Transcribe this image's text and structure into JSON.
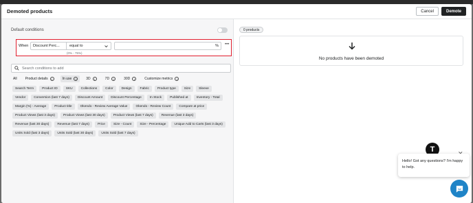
{
  "modal": {
    "title": "Demoted products",
    "cancel_label": "Cancel",
    "demote_label": "Demote"
  },
  "left": {
    "default_conditions_label": "Default conditions",
    "condition": {
      "when_label": "When",
      "field_value": "Discount Perc...",
      "operator_value": "equal to",
      "value_suffix": "%",
      "more_label": "•••",
      "hint": "(0% - 75%)"
    },
    "search_placeholder": "Search conditions to add",
    "tabs": [
      {
        "label": "All",
        "info": false,
        "active": false
      },
      {
        "label": "Product details",
        "info": true,
        "active": false
      },
      {
        "label": "In use",
        "info": true,
        "active": true
      },
      {
        "label": "3D",
        "info": true,
        "active": false
      },
      {
        "label": "7D",
        "info": true,
        "active": false
      },
      {
        "label": "30D",
        "info": true,
        "active": false
      },
      {
        "label": "Customize metrics",
        "info": true,
        "active": false
      }
    ],
    "chips": [
      "Search Term",
      "Product ID",
      "SKU",
      "Collections",
      "Color",
      "Design",
      "Fabric",
      "Product type",
      "Size",
      "Sleeve",
      "Vendor",
      "Conversion (last 7 days)",
      "Discount Amount",
      "Discount Percentage",
      "In Stock",
      "Published at",
      "Inventory - Total",
      "Margin (%) - Average",
      "Product title",
      "Okendo - Review Average Value",
      "Okendo - Review Count",
      "Compare at price",
      "Product Views (last 3 days)",
      "Product Views (last 30 days)",
      "Product Views (last 7 days)",
      "Revenue (last 3 days)",
      "Revenue (last 30 days)",
      "Revenue (last 7 days)",
      "Price",
      "Size - Count",
      "Size - Percentage",
      "Unique Add to Carts (last 3 days)",
      "Units Sold (last 3 days)",
      "Units Sold (last 30 days)",
      "Units Sold (last 7 days)"
    ]
  },
  "right": {
    "count_pill": "0 products",
    "empty_message": "No products have been demoted"
  },
  "chat": {
    "avatar_letter": "T",
    "message": "Hello! Got any questions? I'm happy to help.",
    "close_label": "✕"
  },
  "colors": {
    "highlight_border": "#e11d2d",
    "chat_button": "#1f84c7",
    "primary_button": "#202223"
  }
}
